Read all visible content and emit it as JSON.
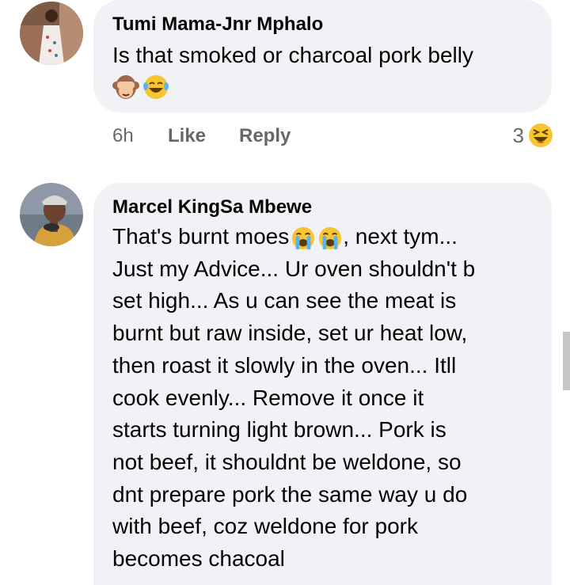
{
  "comments": [
    {
      "author": "Tumi Mama-Jnr Mphalo",
      "lines": [
        "Is that smoked or charcoal pork belly"
      ],
      "emoji_line": [
        "see-no-evil-monkey-emoji",
        "laughing-tears-emoji"
      ],
      "time": "6h",
      "like_label": "Like",
      "reply_label": "Reply",
      "reaction_count": "3",
      "reaction_icon": "laughing-face-emoji"
    },
    {
      "author": "Marcel KingSa Mbewe",
      "lines": [
        "That's burnt moes",
        ", next tym...",
        "Just my Advice... Ur oven shouldn't b",
        "set high... As u can see the meat is",
        "burnt but raw inside, set ur heat low,",
        "then roast it slowly in the oven... Itll",
        "cook evenly... Remove it once it",
        "starts turning light brown... Pork is",
        "not beef, it shouldnt be weldone, so",
        "dnt prepare pork the same way u do",
        "with beef, coz weldone for pork",
        "becomes chacoal"
      ],
      "inline_emoji": [
        "crying-face-emoji",
        "crying-face-emoji"
      ]
    }
  ],
  "colors": {
    "bubble": "#f0f2f5",
    "meta_text": "#65676b",
    "text": "#050505",
    "emoji_yellow": "#f7c52f"
  }
}
